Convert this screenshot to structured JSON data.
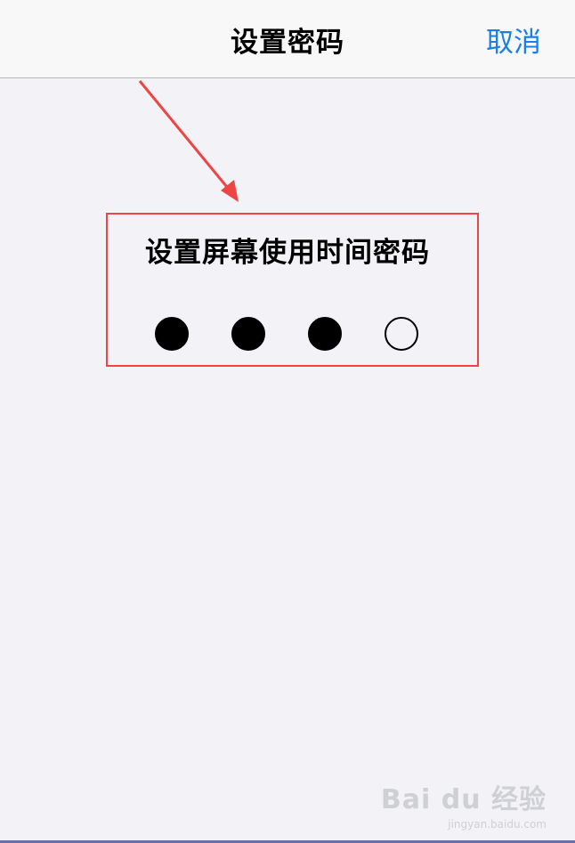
{
  "navbar": {
    "title": "设置密码",
    "cancel_label": "取消"
  },
  "passcode": {
    "prompt": "设置屏幕使用时间密码",
    "digits_total": 4,
    "digits_entered": 3
  },
  "annotation": {
    "arrow_color": "#ee4444",
    "box_color": "#ee4444"
  },
  "watermark": {
    "main": "Bai du 经验",
    "sub": "jingyan.baidu.com"
  },
  "colors": {
    "accent": "#1a7fe8",
    "background": "#f2f2f7",
    "navbar": "#f8f8f8"
  }
}
